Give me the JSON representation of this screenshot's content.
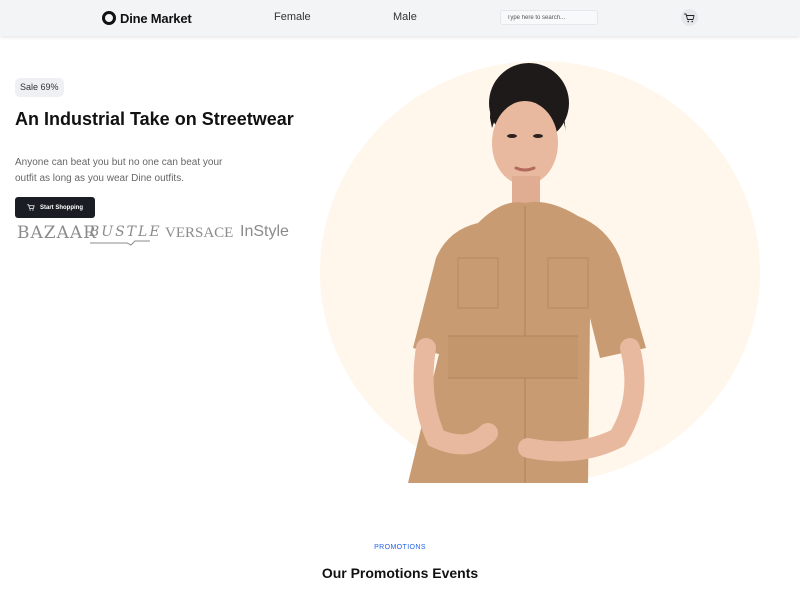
{
  "header": {
    "logo_text": "Dine Market",
    "nav": [
      {
        "label": "Female"
      },
      {
        "label": "Male"
      }
    ],
    "search_placeholder": "Type here to search...",
    "cart_icon": "cart-icon"
  },
  "hero": {
    "badge": "Sale 69%",
    "title": "An Industrial Take on Streetwear",
    "description": "Anyone can beat you but no one can beat your outfit as long as you wear Dine outfits.",
    "cta_label": "Start Shopping",
    "brands": [
      "BAZAAR",
      "BUSTLE",
      "VERSACE",
      "InStyle"
    ]
  },
  "promotions": {
    "tag": "PROMOTIONS",
    "title": "Our Promotions Events"
  },
  "colors": {
    "accent_blue": "#2563eb",
    "cta_bg": "#1a1d24",
    "hero_circle": "#fff6ec",
    "header_bg": "#f3f4f6"
  }
}
